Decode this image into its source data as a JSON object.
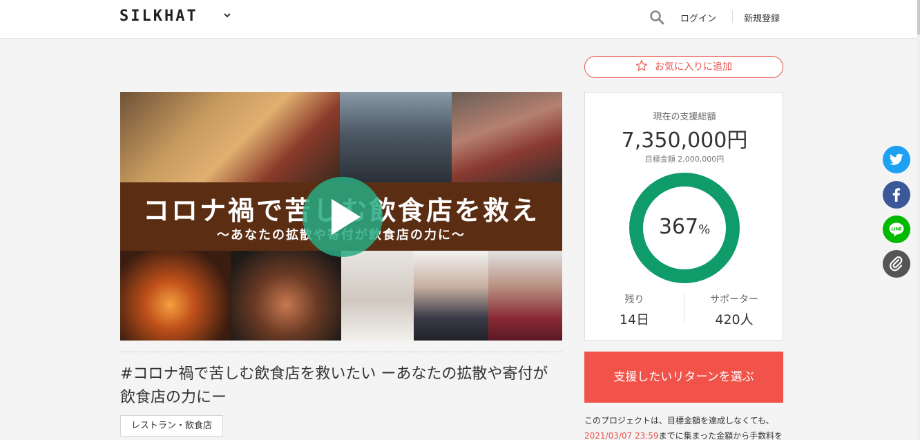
{
  "header": {
    "logo": "SILKHAT",
    "login_label": "ログイン",
    "register_label": "新規登録"
  },
  "hero": {
    "banner_title": "コロナ禍で苦しむ飲食店を救え",
    "banner_subtitle": "〜あなたの拡散や寄付が飲食店の力に〜"
  },
  "project": {
    "title": "#コロナ禍で苦しむ飲食店を救いたい ーあなたの拡散や寄付が飲食店の力にー",
    "category": "レストラン・飲食店"
  },
  "sidebar": {
    "favorite_label": "お気に入りに追加",
    "total_label": "現在の支援総額",
    "total_amount": "7,350,000円",
    "goal_text": "目標金額 2,000,000円",
    "progress_percent": "367",
    "progress_unit": "%",
    "remaining_label": "残り",
    "remaining_value": "14日",
    "supporters_label": "サポーター",
    "supporters_value": "420人",
    "cta_label": "支援したいリターンを選ぶ",
    "note_line1": "このプロジェクトは、目標金額を達成しなくても、",
    "note_deadline": "2021/03/07 23:59",
    "note_line2": "までに集まった金額から手数料を"
  },
  "share": {
    "icons": [
      "twitter-icon",
      "facebook-icon",
      "line-icon",
      "link-icon"
    ],
    "colors": {
      "twitter": "#1da1f2",
      "facebook": "#3b5998",
      "line": "#00b900",
      "link": "#555555"
    }
  },
  "colors": {
    "accent": "#f1534a",
    "ring": "#0f9b6a"
  }
}
